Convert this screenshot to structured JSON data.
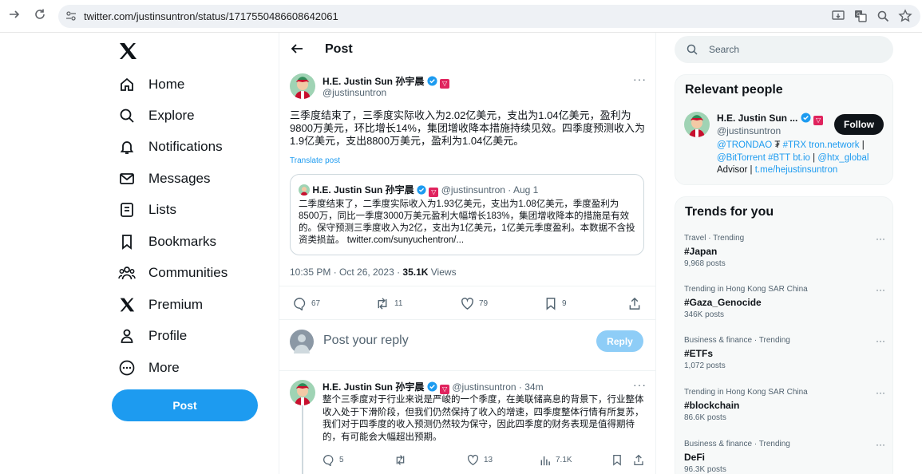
{
  "browser": {
    "url": "twitter.com/justinsuntron/status/1717550486608642061"
  },
  "nav": {
    "items": [
      {
        "label": "Home",
        "icon": "home-icon"
      },
      {
        "label": "Explore",
        "icon": "search-icon"
      },
      {
        "label": "Notifications",
        "icon": "bell-icon"
      },
      {
        "label": "Messages",
        "icon": "envelope-icon"
      },
      {
        "label": "Lists",
        "icon": "list-icon"
      },
      {
        "label": "Bookmarks",
        "icon": "bookmark-icon"
      },
      {
        "label": "Communities",
        "icon": "people-icon"
      },
      {
        "label": "Premium",
        "icon": "x-icon"
      },
      {
        "label": "Profile",
        "icon": "person-icon"
      },
      {
        "label": "More",
        "icon": "more-circle-icon"
      }
    ],
    "post_button": "Post"
  },
  "header": {
    "title": "Post"
  },
  "tweet": {
    "author_name": "H.E. Justin Sun 孙宇晨",
    "handle": "@justinsuntron",
    "text": "三季度结束了，三季度实际收入为2.02亿美元，支出为1.04亿美元，盈利为9800万美元，环比增长14%，集团增收降本措施持续见效。四季度预测收入为1.9亿美元，支出8800万美元，盈利为1.04亿美元。",
    "translate": "Translate post",
    "timestamp": "10:35 PM · Oct 26, 2023 · ",
    "views_count": "35.1K",
    "views_label": " Views",
    "stats": {
      "replies": "67",
      "retweets": "11",
      "likes": "79",
      "bookmarks": "9"
    }
  },
  "quote": {
    "author_name": "H.E. Justin Sun 孙宇晨",
    "handle_date": "@justinsuntron · Aug 1",
    "text": "二季度结束了，二季度实际收入为1.93亿美元，支出为1.08亿美元，季度盈利为8500万，同比一季度3000万美元盈利大幅增长183%，集团增收降本的措施是有效的。保守预测三季度收入为2亿，支出为1亿美元，1亿美元季度盈利。本数据不含投资类损益。 twitter.com/sunyuchentron/..."
  },
  "compose": {
    "placeholder": "Post your reply",
    "reply_button": "Reply"
  },
  "reply": {
    "author_name": "H.E. Justin Sun 孙宇晨",
    "handle_time": "@justinsuntron · 34m",
    "text": "整个三季度对于行业来说是严峻的一个季度，在美联储高息的背景下，行业整体收入处于下滑阶段，但我们仍然保持了收入的增速，四季度整体行情有所复苏，我们对于四季度的收入预测仍然较为保守，因此四季度的财务表现是值得期待的，有可能会大幅超出预期。",
    "stats": {
      "replies": "5",
      "likes": "13",
      "views": "7.1K"
    }
  },
  "search": {
    "placeholder": "Search"
  },
  "relevant": {
    "title": "Relevant people",
    "name": "H.E. Justin Sun ...",
    "handle": "@justinsuntron",
    "follow": "Follow",
    "bio_1": "@TRONDAO",
    "bio_2": " ₮ ",
    "bio_3": "#TRX",
    "bio_4": " ",
    "bio_5": "tron.network",
    "bio_6": " | ",
    "bio_7": "@BitTorrent",
    "bio_8": " ",
    "bio_9": "#BTT",
    "bio_10": " ",
    "bio_11": "bt.io",
    "bio_12": " | ",
    "bio_13": "@htx_global",
    "bio_14": "Advisor | ",
    "bio_15": "t.me/hejustinsuntron"
  },
  "trends": {
    "title": "Trends for you",
    "items": [
      {
        "context": "Travel · Trending",
        "name": "#Japan",
        "count": "9,968 posts"
      },
      {
        "context": "Trending in Hong Kong SAR China",
        "name": "#Gaza_Genocide",
        "count": "346K posts"
      },
      {
        "context": "Business & finance · Trending",
        "name": "#ETFs",
        "count": "1,072 posts"
      },
      {
        "context": "Trending in Hong Kong SAR China",
        "name": "#blockchain",
        "count": "86.6K posts"
      },
      {
        "context": "Business & finance · Trending",
        "name": "DeFi",
        "count": "96.3K posts"
      }
    ]
  },
  "colors": {
    "accent": "#1d9bf0",
    "text": "#0f1419",
    "secondary": "#536471"
  }
}
